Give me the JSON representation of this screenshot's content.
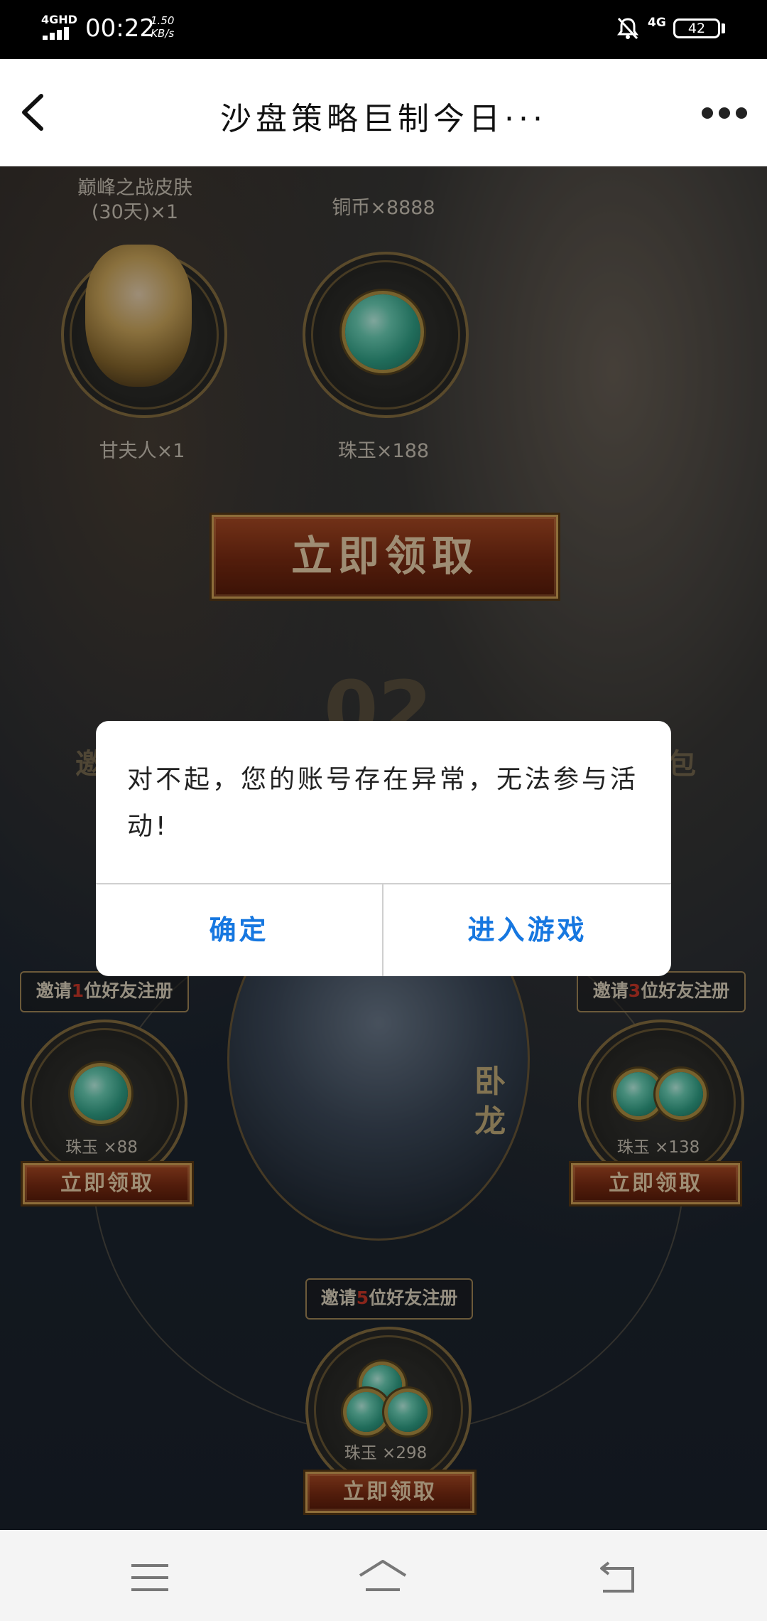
{
  "status_bar": {
    "network": "4GHD",
    "time": "00:22",
    "speed_value": "1.50",
    "speed_unit": "KB/s",
    "network2": "4G",
    "battery": "42"
  },
  "title_bar": {
    "title": "沙盘策略巨制今日···"
  },
  "rewards_top": {
    "skin_label_line1": "巅峰之战皮肤",
    "skin_label_line2": "(30天)×1",
    "coin_label": "铜币×8888",
    "lady_label": "甘夫人×1",
    "jade_label": "珠玉×188",
    "claim_button": "立即领取"
  },
  "background_text": {
    "section_number": "02",
    "left_fragment": "邀",
    "right_fragment": "包"
  },
  "invite_rewards": [
    {
      "tag_prefix": "邀请",
      "count": "1",
      "tag_suffix": "位好友注册",
      "amount": "珠玉 ×88",
      "button": "立即领取"
    },
    {
      "tag_prefix": "邀请",
      "count": "3",
      "tag_suffix": "位好友注册",
      "amount": "珠玉 ×138",
      "button": "立即领取"
    },
    {
      "tag_prefix": "邀请",
      "count": "5",
      "tag_suffix": "位好友注册",
      "amount": "珠玉 ×298",
      "button": "立即领取"
    }
  ],
  "hero": {
    "name": "卧龙"
  },
  "dialog": {
    "message": "对不起，您的账号存在异常，无法参与活动!",
    "confirm": "确定",
    "enter_game": "进入游戏"
  },
  "colors": {
    "dialog_button": "#1677e0",
    "invite_count": "#d23a2a",
    "gold": "#d9a85a"
  },
  "icons": [
    "back-arrow-icon",
    "more-dots-icon",
    "mute-bell-icon",
    "battery-icon",
    "menu-icon",
    "home-icon",
    "back-icon"
  ]
}
